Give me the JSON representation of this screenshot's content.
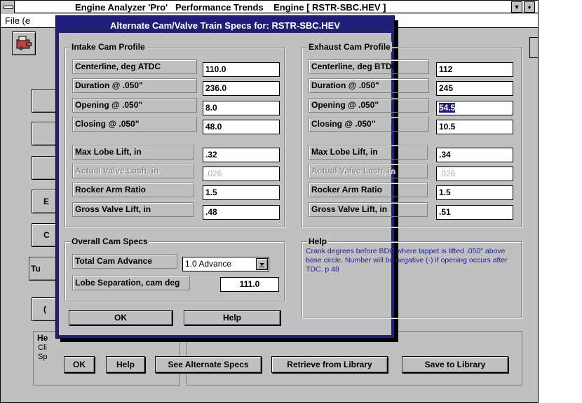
{
  "parent": {
    "title": "Engine Analyzer 'Pro'   Performance Trends    Engine [ RSTR-SBC.HEV ]",
    "menu_file": "File (e",
    "stub_buttons": [
      "",
      "",
      "",
      "E",
      "C",
      "Tu",
      "("
    ],
    "help_title": "He",
    "help_lines": [
      "Cli",
      "Sp"
    ],
    "buttons": {
      "ok": "OK",
      "help": "Help",
      "see_alternate": "See Alternate Specs",
      "retrieve": "Retrieve from Library",
      "save": "Save to Library"
    }
  },
  "dialog": {
    "title": "Alternate Cam/Valve Train Specs for: RSTR-SBC.HEV",
    "intake": {
      "title": "Intake Cam Profile",
      "rows": [
        {
          "label": "Centerline, deg ATDC",
          "value": "110.0"
        },
        {
          "label": "Duration @ .050\"",
          "value": "236.0"
        },
        {
          "label": "Opening @ .050\"",
          "value": "8.0"
        },
        {
          "label": "Closing @ .050\"",
          "value": "48.0"
        }
      ],
      "lift_rows": [
        {
          "label": "Max Lobe Lift, in",
          "value": ".32"
        },
        {
          "label": "Actual Valve Lash, in",
          "value": ".026"
        },
        {
          "label": "Rocker Arm Ratio",
          "value": "1.5"
        },
        {
          "label": "Gross Valve Lift, in",
          "value": ".48"
        }
      ]
    },
    "exhaust": {
      "title": "Exhaust Cam Profile",
      "rows": [
        {
          "label": "Centerline, deg BTDC",
          "value": "112"
        },
        {
          "label": "Duration @ .050\"",
          "value": "245"
        },
        {
          "label": "Opening @ .050\"",
          "value": "54.5"
        },
        {
          "label": "Closing @ .050\"",
          "value": "10.5"
        }
      ],
      "lift_rows": [
        {
          "label": "Max Lobe Lift, in",
          "value": ".34"
        },
        {
          "label": "Actual Valve Lash, in",
          "value": ".026"
        },
        {
          "label": "Rocker Arm Ratio",
          "value": "1.5"
        },
        {
          "label": "Gross Valve Lift, in",
          "value": ".51"
        }
      ]
    },
    "overall": {
      "title": "Overall Cam Specs",
      "total_advance_label": "Total Cam Advance",
      "total_advance_value": "1.0 Advance",
      "lobe_sep_label": "Lobe Separation, cam deg",
      "lobe_sep_value": "111.0"
    },
    "help": {
      "title": "Help",
      "text": "Crank degrees before BDC where tappet is lifted .050\" above base circle.  Number will be negative (-) if opening occurs after TDC.  p 48"
    },
    "buttons": {
      "ok": "OK",
      "help": "Help"
    }
  },
  "colors": {
    "dialog_title_bg": "#1f1f7a",
    "window_bg": "#c0c0c0",
    "help_text": "#1f1f9a"
  }
}
